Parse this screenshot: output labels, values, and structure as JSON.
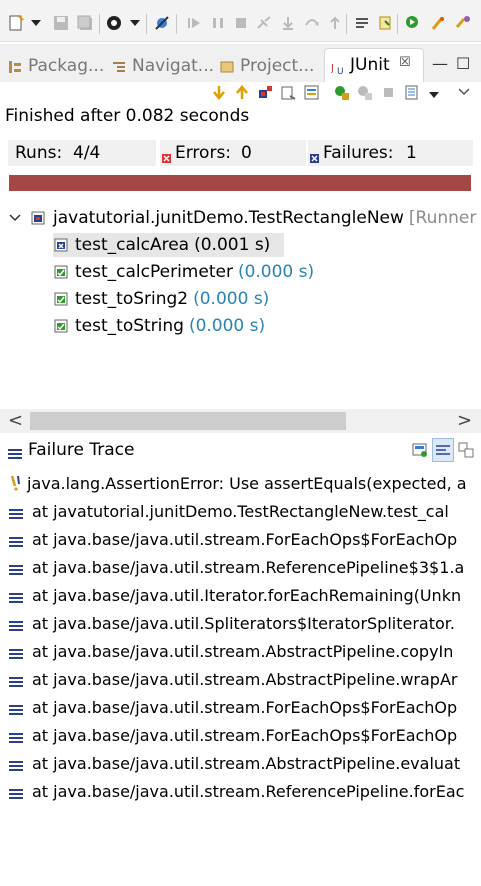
{
  "tabs": [
    {
      "label": "Packag..."
    },
    {
      "label": "Navigat..."
    },
    {
      "label": "Project..."
    }
  ],
  "active_tab": {
    "label": "JUnit",
    "close": "☒"
  },
  "window_buttons": {
    "minimize": "—",
    "maximize": "☐"
  },
  "status": "Finished after 0.082 seconds",
  "counters": {
    "runs_label": "Runs:",
    "runs_value": "4/4",
    "errors_label": "Errors:",
    "errors_value": "0",
    "failures_label": "Failures:",
    "failures_value": "1"
  },
  "progress": {
    "fraction": 1.0,
    "color": "#a54745"
  },
  "tree": {
    "suite": {
      "name": "javatutorial.junitDemo.TestRectangleNew",
      "runner": "[Runner"
    },
    "tests": [
      {
        "name": "test_calcArea",
        "time": "(0.001 s)",
        "status": "failed",
        "selected": true
      },
      {
        "name": "test_calcPerimeter",
        "time": "(0.000 s)",
        "status": "passed",
        "selected": false
      },
      {
        "name": "test_toSring2",
        "time": "(0.000 s)",
        "status": "passed",
        "selected": false
      },
      {
        "name": "test_toString",
        "time": "(0.000 s)",
        "status": "passed",
        "selected": false
      }
    ]
  },
  "scroll": {
    "left": "<",
    "right": ">"
  },
  "failure_trace": {
    "title": "Failure Trace",
    "lines": [
      "java.lang.AssertionError: Use assertEquals(expected, a",
      "at javatutorial.junitDemo.TestRectangleNew.test_cal",
      "at java.base/java.util.stream.ForEachOps$ForEachOp",
      "at java.base/java.util.stream.ReferencePipeline$3$1.a",
      "at java.base/java.util.Iterator.forEachRemaining(Unkn",
      "at java.base/java.util.Spliterators$IteratorSpliterator.",
      "at java.base/java.util.stream.AbstractPipeline.copyIn",
      "at java.base/java.util.stream.AbstractPipeline.wrapAr",
      "at java.base/java.util.stream.ForEachOps$ForEachOp",
      "at java.base/java.util.stream.ForEachOps$ForEachOp",
      "at java.base/java.util.stream.AbstractPipeline.evaluat",
      "at java.base/java.util.stream.ReferencePipeline.forEac"
    ]
  },
  "colors": {
    "failure_bar": "#a54745",
    "time_text": "#2a84b0",
    "muted_text": "#8c8c8c"
  },
  "icons": [
    "new-icon",
    "save-icon",
    "save-all-icon",
    "debug-icon",
    "skip-breakpoints-icon",
    "resume-icon",
    "suspend-icon",
    "terminate-icon",
    "disconnect-icon",
    "step-into-icon",
    "step-over-icon",
    "step-return-icon",
    "drop-to-frame-icon",
    "next-annotation-icon",
    "prev-annotation-icon",
    "run-icon",
    "external-tools-icon",
    "search-icon"
  ]
}
